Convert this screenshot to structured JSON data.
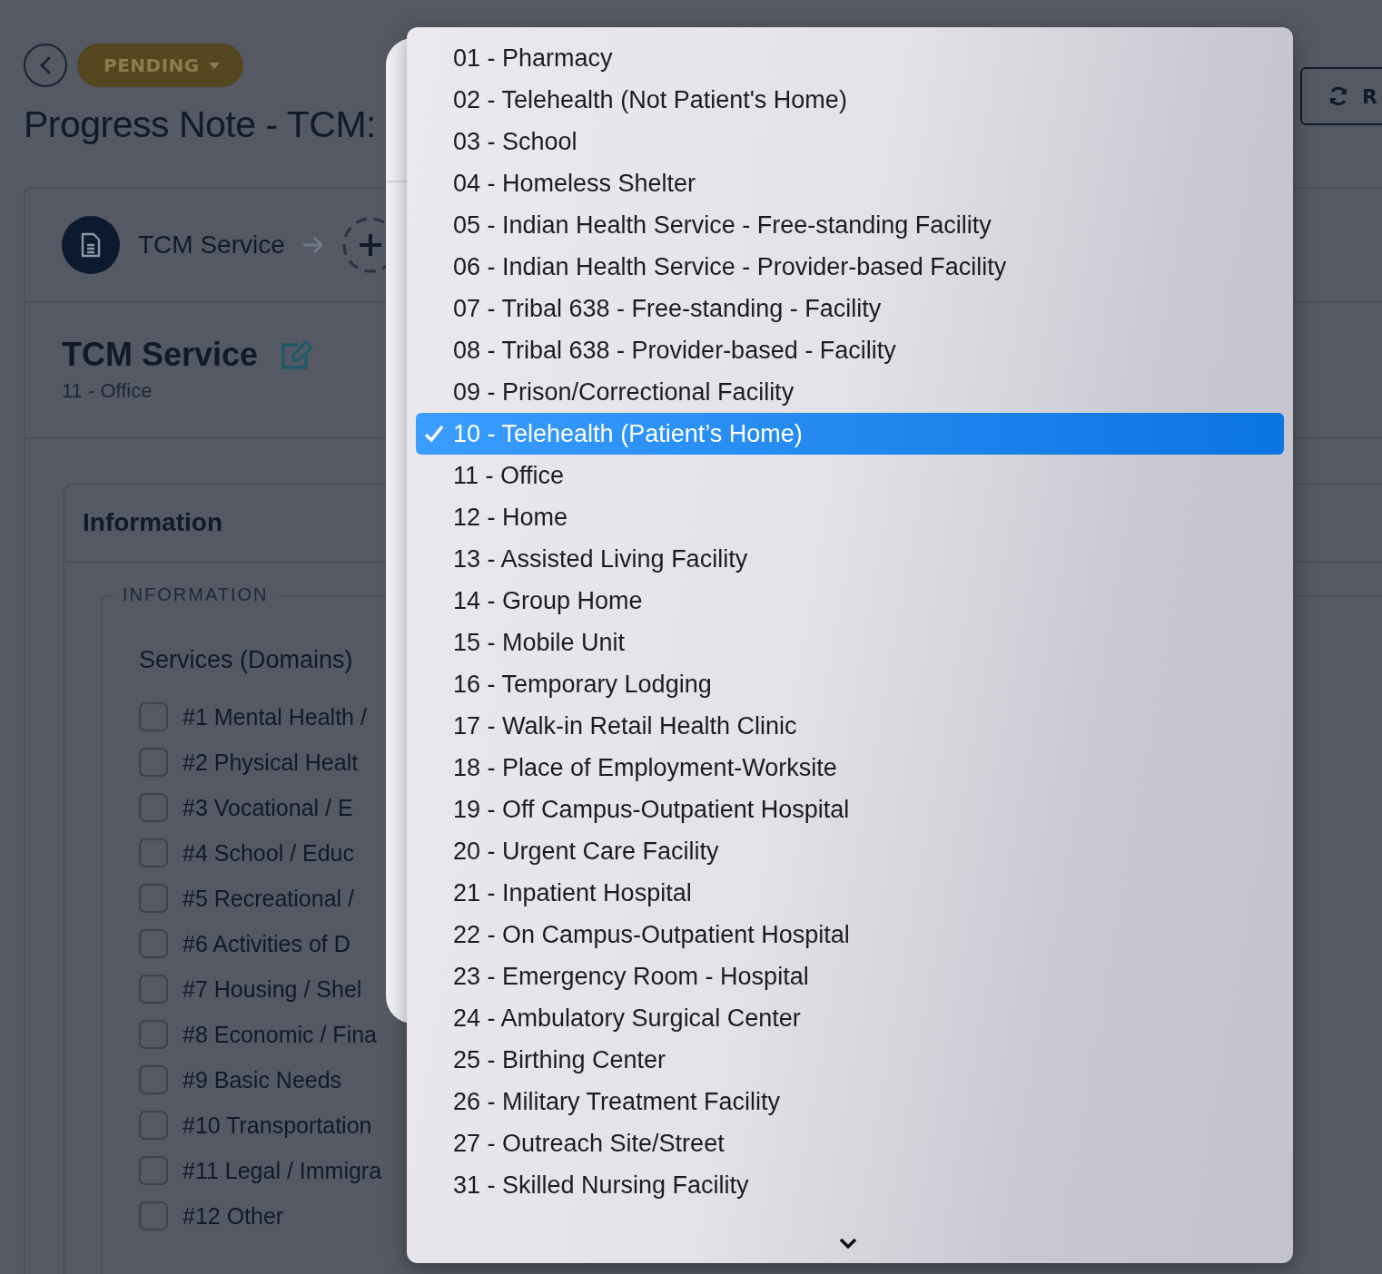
{
  "header": {
    "status": "PENDING",
    "title": "Progress Note - TCM:",
    "refresh_label": "R"
  },
  "stepper": {
    "step_label": "TCM Service"
  },
  "service": {
    "title": "TCM Service",
    "subtitle": "11 - Office"
  },
  "information": {
    "header": "Information",
    "legend": "INFORMATION",
    "group_label": "Services (Domains)",
    "options": [
      {
        "label": "#1 Mental Health /",
        "checked": false
      },
      {
        "label": "#2 Physical Healt",
        "checked": false
      },
      {
        "label": "#3 Vocational / E",
        "checked": false
      },
      {
        "label": "#4 School / Educ",
        "checked": false
      },
      {
        "label": "#5 Recreational /",
        "checked": false
      },
      {
        "label": "#6 Activities of D",
        "checked": false
      },
      {
        "label": "#7 Housing / Shel",
        "checked": false
      },
      {
        "label": "#8 Economic / Fina",
        "checked": false
      },
      {
        "label": "#9 Basic Needs",
        "checked": false
      },
      {
        "label": "#10 Transportation",
        "checked": false
      },
      {
        "label": "#11 Legal / Immigra",
        "checked": false
      },
      {
        "label": "#12 Other",
        "checked": false
      }
    ]
  },
  "dropdown": {
    "options": [
      {
        "label": "01 - Pharmacy",
        "selected": false
      },
      {
        "label": "02 - Telehealth (Not Patient's Home)",
        "selected": false
      },
      {
        "label": "03 - School",
        "selected": false
      },
      {
        "label": "04 - Homeless Shelter",
        "selected": false
      },
      {
        "label": "05 - Indian Health Service - Free-standing Facility",
        "selected": false
      },
      {
        "label": "06 - Indian Health Service - Provider-based Facility",
        "selected": false
      },
      {
        "label": "07 - Tribal 638 - Free-standing - Facility",
        "selected": false
      },
      {
        "label": "08 - Tribal 638 - Provider-based - Facility",
        "selected": false
      },
      {
        "label": "09 - Prison/Correctional Facility",
        "selected": false
      },
      {
        "label": "10 - Telehealth (Patient’s Home)",
        "selected": true
      },
      {
        "label": "11 - Office",
        "selected": false
      },
      {
        "label": "12 - Home",
        "selected": false
      },
      {
        "label": "13 - Assisted Living Facility",
        "selected": false
      },
      {
        "label": "14 - Group Home",
        "selected": false
      },
      {
        "label": "15 - Mobile Unit",
        "selected": false
      },
      {
        "label": "16 - Temporary Lodging",
        "selected": false
      },
      {
        "label": "17 - Walk-in Retail Health Clinic",
        "selected": false
      },
      {
        "label": "18 - Place of Employment-Worksite",
        "selected": false
      },
      {
        "label": "19 - Off Campus-Outpatient Hospital",
        "selected": false
      },
      {
        "label": "20 - Urgent Care Facility",
        "selected": false
      },
      {
        "label": "21 - Inpatient Hospital",
        "selected": false
      },
      {
        "label": "22 - On Campus-Outpatient Hospital",
        "selected": false
      },
      {
        "label": "23 - Emergency Room - Hospital",
        "selected": false
      },
      {
        "label": "24 - Ambulatory Surgical Center",
        "selected": false
      },
      {
        "label": "25 - Birthing Center",
        "selected": false
      },
      {
        "label": "26 - Military Treatment Facility",
        "selected": false
      },
      {
        "label": "27 - Outreach Site/Street",
        "selected": false
      },
      {
        "label": "31 - Skilled Nursing Facility",
        "selected": false
      }
    ]
  }
}
